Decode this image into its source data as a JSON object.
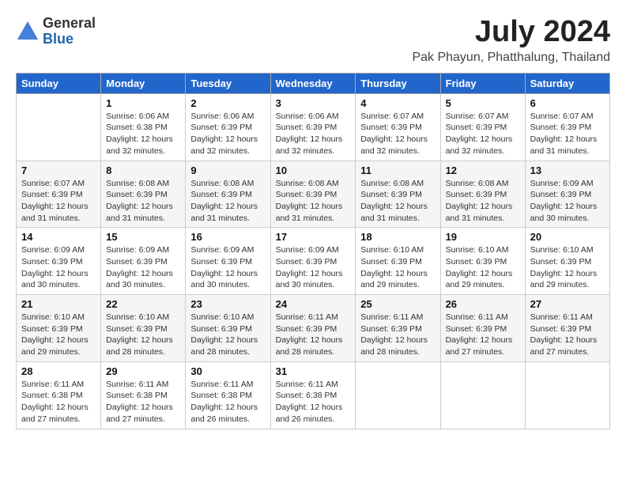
{
  "logo": {
    "general": "General",
    "blue": "Blue"
  },
  "title": {
    "month": "July 2024",
    "location": "Pak Phayun, Phatthalung, Thailand"
  },
  "weekdays": [
    "Sunday",
    "Monday",
    "Tuesday",
    "Wednesday",
    "Thursday",
    "Friday",
    "Saturday"
  ],
  "weeks": [
    [
      {
        "day": "",
        "sunrise": "",
        "sunset": "",
        "daylight": ""
      },
      {
        "day": "1",
        "sunrise": "6:06 AM",
        "sunset": "6:38 PM",
        "daylight": "12 hours and 32 minutes."
      },
      {
        "day": "2",
        "sunrise": "6:06 AM",
        "sunset": "6:39 PM",
        "daylight": "12 hours and 32 minutes."
      },
      {
        "day": "3",
        "sunrise": "6:06 AM",
        "sunset": "6:39 PM",
        "daylight": "12 hours and 32 minutes."
      },
      {
        "day": "4",
        "sunrise": "6:07 AM",
        "sunset": "6:39 PM",
        "daylight": "12 hours and 32 minutes."
      },
      {
        "day": "5",
        "sunrise": "6:07 AM",
        "sunset": "6:39 PM",
        "daylight": "12 hours and 32 minutes."
      },
      {
        "day": "6",
        "sunrise": "6:07 AM",
        "sunset": "6:39 PM",
        "daylight": "12 hours and 31 minutes."
      }
    ],
    [
      {
        "day": "7",
        "sunrise": "6:07 AM",
        "sunset": "6:39 PM",
        "daylight": "12 hours and 31 minutes."
      },
      {
        "day": "8",
        "sunrise": "6:08 AM",
        "sunset": "6:39 PM",
        "daylight": "12 hours and 31 minutes."
      },
      {
        "day": "9",
        "sunrise": "6:08 AM",
        "sunset": "6:39 PM",
        "daylight": "12 hours and 31 minutes."
      },
      {
        "day": "10",
        "sunrise": "6:08 AM",
        "sunset": "6:39 PM",
        "daylight": "12 hours and 31 minutes."
      },
      {
        "day": "11",
        "sunrise": "6:08 AM",
        "sunset": "6:39 PM",
        "daylight": "12 hours and 31 minutes."
      },
      {
        "day": "12",
        "sunrise": "6:08 AM",
        "sunset": "6:39 PM",
        "daylight": "12 hours and 31 minutes."
      },
      {
        "day": "13",
        "sunrise": "6:09 AM",
        "sunset": "6:39 PM",
        "daylight": "12 hours and 30 minutes."
      }
    ],
    [
      {
        "day": "14",
        "sunrise": "6:09 AM",
        "sunset": "6:39 PM",
        "daylight": "12 hours and 30 minutes."
      },
      {
        "day": "15",
        "sunrise": "6:09 AM",
        "sunset": "6:39 PM",
        "daylight": "12 hours and 30 minutes."
      },
      {
        "day": "16",
        "sunrise": "6:09 AM",
        "sunset": "6:39 PM",
        "daylight": "12 hours and 30 minutes."
      },
      {
        "day": "17",
        "sunrise": "6:09 AM",
        "sunset": "6:39 PM",
        "daylight": "12 hours and 30 minutes."
      },
      {
        "day": "18",
        "sunrise": "6:10 AM",
        "sunset": "6:39 PM",
        "daylight": "12 hours and 29 minutes."
      },
      {
        "day": "19",
        "sunrise": "6:10 AM",
        "sunset": "6:39 PM",
        "daylight": "12 hours and 29 minutes."
      },
      {
        "day": "20",
        "sunrise": "6:10 AM",
        "sunset": "6:39 PM",
        "daylight": "12 hours and 29 minutes."
      }
    ],
    [
      {
        "day": "21",
        "sunrise": "6:10 AM",
        "sunset": "6:39 PM",
        "daylight": "12 hours and 29 minutes."
      },
      {
        "day": "22",
        "sunrise": "6:10 AM",
        "sunset": "6:39 PM",
        "daylight": "12 hours and 28 minutes."
      },
      {
        "day": "23",
        "sunrise": "6:10 AM",
        "sunset": "6:39 PM",
        "daylight": "12 hours and 28 minutes."
      },
      {
        "day": "24",
        "sunrise": "6:11 AM",
        "sunset": "6:39 PM",
        "daylight": "12 hours and 28 minutes."
      },
      {
        "day": "25",
        "sunrise": "6:11 AM",
        "sunset": "6:39 PM",
        "daylight": "12 hours and 28 minutes."
      },
      {
        "day": "26",
        "sunrise": "6:11 AM",
        "sunset": "6:39 PM",
        "daylight": "12 hours and 27 minutes."
      },
      {
        "day": "27",
        "sunrise": "6:11 AM",
        "sunset": "6:39 PM",
        "daylight": "12 hours and 27 minutes."
      }
    ],
    [
      {
        "day": "28",
        "sunrise": "6:11 AM",
        "sunset": "6:38 PM",
        "daylight": "12 hours and 27 minutes."
      },
      {
        "day": "29",
        "sunrise": "6:11 AM",
        "sunset": "6:38 PM",
        "daylight": "12 hours and 27 minutes."
      },
      {
        "day": "30",
        "sunrise": "6:11 AM",
        "sunset": "6:38 PM",
        "daylight": "12 hours and 26 minutes."
      },
      {
        "day": "31",
        "sunrise": "6:11 AM",
        "sunset": "6:38 PM",
        "daylight": "12 hours and 26 minutes."
      },
      {
        "day": "",
        "sunrise": "",
        "sunset": "",
        "daylight": ""
      },
      {
        "day": "",
        "sunrise": "",
        "sunset": "",
        "daylight": ""
      },
      {
        "day": "",
        "sunrise": "",
        "sunset": "",
        "daylight": ""
      }
    ]
  ]
}
